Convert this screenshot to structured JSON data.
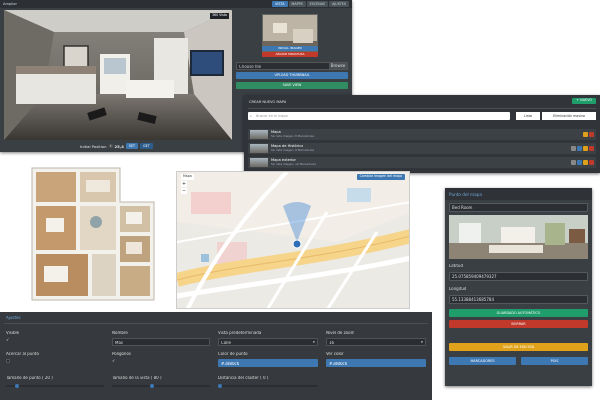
{
  "editor": {
    "title": "Ampliar",
    "tabs": [
      "VISTA",
      "MAPPS",
      "ESCENAS",
      "AJUSTES"
    ],
    "active_tab": 0,
    "view_badge": "360 Vista",
    "initial_position_label": "Initial Position",
    "initial_position_value": "25,4",
    "set_button": "SET",
    "get_button": "GET",
    "thumb_btn_1": "INICIAL IMAGEN",
    "thumb_btn_2": "AÑADIR MINIATURA",
    "file_label": "Choose file",
    "file_button": "Browse",
    "upload_button": "UPLOAD THUMBNAIL",
    "save_button": "SAVE VIEW"
  },
  "maps": {
    "title": "CREAR NUEVO MAPA",
    "add_button": "+ NUEVO",
    "search_placeholder": "Buscar en el mapa",
    "search_btn": "Lista",
    "filter_btn": "Eliminación masiva",
    "items": [
      {
        "name": "Mapa",
        "sub": "Sin lista imagen, 8 Marcadores"
      },
      {
        "name": "Mapa de Histórico",
        "sub": "Sin lista imagen, 8 Marcadores"
      },
      {
        "name": "Mapa exterior",
        "sub": "Sin lista imagen, 12 Marcadores"
      }
    ]
  },
  "map_view": {
    "top_label": "Mapa",
    "top_button": "Cambiar imagen del mapa",
    "zoom_in": "+",
    "zoom_out": "−"
  },
  "settings": {
    "title": "Ajustes",
    "labels": {
      "visible": "Visible",
      "name": "Nombre",
      "default_view": "Vista predeterminada",
      "zoom_level": "Nivel de zoom",
      "center_point": "Acercar al punto",
      "polygons": "Polígonos",
      "point_color": "Color de punto",
      "view_color": "Ver color",
      "point_size": "Tamaño de punto ( 20 )",
      "view_size": "Tamaño de la vista ( 80 )",
      "cluster_distance": "Distancia del clúster ( 0 )"
    },
    "values": {
      "name": "Mas",
      "default_view": "Calle",
      "zoom_level": "16",
      "point_color": "#3d80c6",
      "view_color": "#3d80c6"
    },
    "sliders": {
      "point_size": 0.1,
      "view_size": 0.4,
      "cluster_distance": 0.0
    }
  },
  "point_panel": {
    "title": "Punto del mapa",
    "room_select": "Bed Room",
    "lat_label": "Latitud",
    "lat_value": "25.075859409479327",
    "lon_label": "Longitud",
    "lon_value": "55.13388413685784",
    "btn_auto": "GUARDADO AUTOMÁTICO",
    "btn_delete": "BORRAR",
    "btn_exit": "SALIR DE EDICIÓN",
    "btn_markers": "MARCADORES",
    "btn_pois": "POIS"
  },
  "colors": {
    "primary": "#3d78b3",
    "success": "#1f9d6a",
    "danger": "#c0392b",
    "warning": "#e0a21b",
    "dark": "#3a3f44"
  }
}
